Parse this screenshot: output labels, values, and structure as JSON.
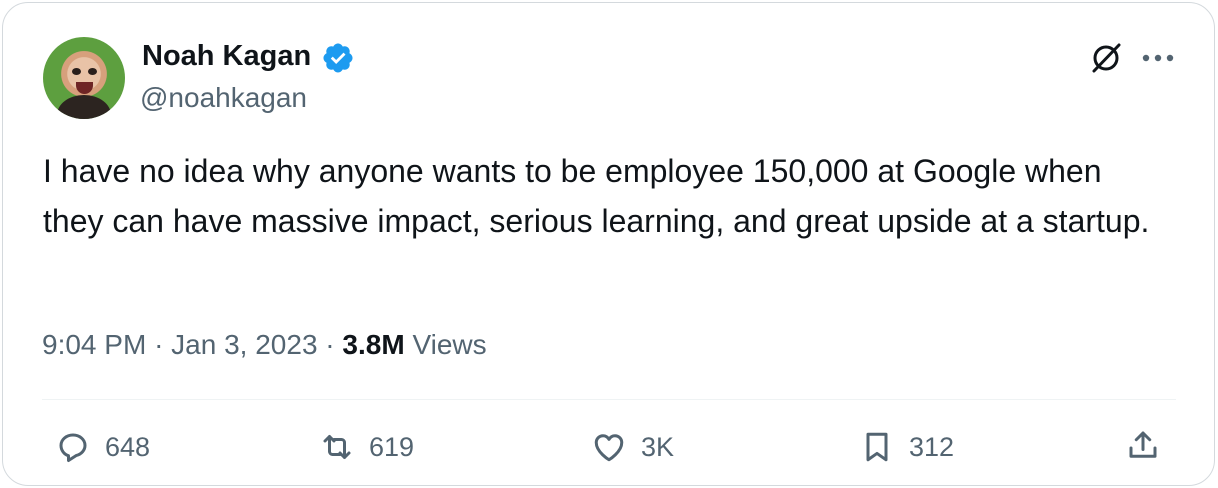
{
  "author": {
    "name": "Noah Kagan",
    "handle": "@noahkagan"
  },
  "tweet": {
    "text": "I have no idea why anyone wants to be employee 150,000 at Google when they can have massive impact, serious learning, and great upside at a startup."
  },
  "meta": {
    "time": "9:04 PM",
    "separator": "·",
    "date": "Jan 3, 2023",
    "views_count": "3.8M",
    "views_label": "Views"
  },
  "actions": {
    "replies": "648",
    "reposts": "619",
    "likes": "3K",
    "bookmarks": "312"
  },
  "icons": {
    "verified": "verified-badge-icon",
    "grok": "grok-icon",
    "more": "more-horizontal-icon",
    "reply": "reply-icon",
    "repost": "repost-icon",
    "like": "heart-icon",
    "bookmark": "bookmark-icon",
    "share": "share-icon"
  },
  "colors": {
    "text": "#0f1419",
    "secondary": "#536471",
    "verified": "#1d9bf0",
    "border": "#d4d9dd"
  }
}
